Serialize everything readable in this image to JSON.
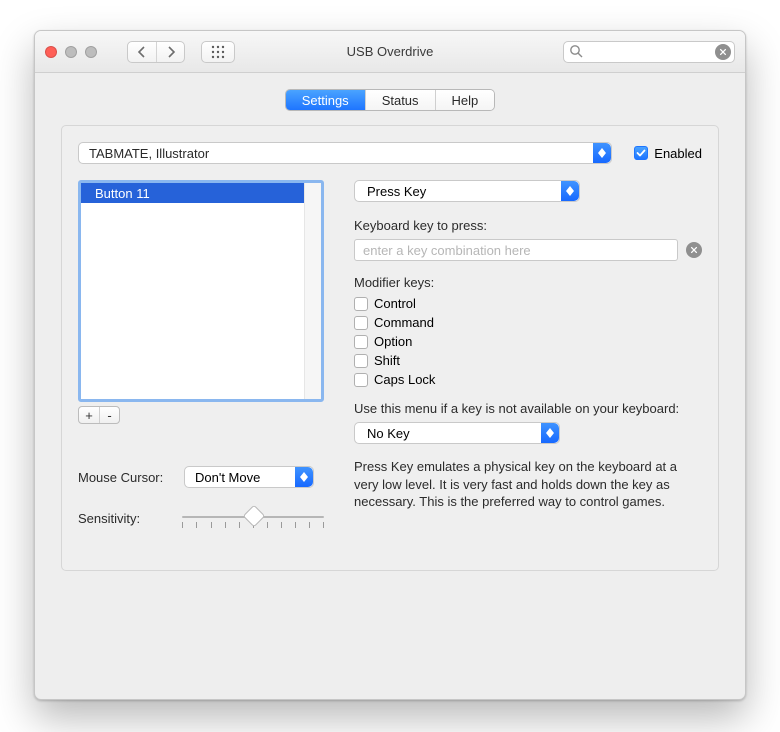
{
  "window": {
    "title": "USB Overdrive"
  },
  "toolbar": {
    "search_placeholder": ""
  },
  "tabs": {
    "settings": "Settings",
    "status": "Status",
    "help": "Help",
    "active": "settings"
  },
  "profile": {
    "selected": "TABMATE, Illustrator",
    "enabled_label": "Enabled",
    "enabled_checked": true
  },
  "button_list": {
    "items": [
      "Button 11"
    ],
    "selected_index": 0,
    "add_label": "+",
    "remove_label": "-"
  },
  "left_controls": {
    "mouse_cursor_label": "Mouse Cursor:",
    "mouse_cursor_value": "Don't Move",
    "sensitivity_label": "Sensitivity:",
    "sensitivity_percent": 50
  },
  "action": {
    "type_value": "Press Key",
    "keyboard_prompt": "Keyboard key to press:",
    "key_field_placeholder": "enter a key combination here",
    "modifiers_label": "Modifier keys:",
    "modifiers": {
      "control": {
        "label": "Control",
        "checked": false
      },
      "command": {
        "label": "Command",
        "checked": false
      },
      "option": {
        "label": "Option",
        "checked": false
      },
      "shift": {
        "label": "Shift",
        "checked": false
      },
      "caps": {
        "label": "Caps Lock",
        "checked": false
      }
    },
    "fallback_prompt": "Use this menu if a key is not available on your keyboard:",
    "fallback_value": "No Key",
    "description": "Press Key emulates a physical key on the keyboard at a very low level. It is very fast and holds down the key as necessary. This is the preferred way to control games."
  }
}
